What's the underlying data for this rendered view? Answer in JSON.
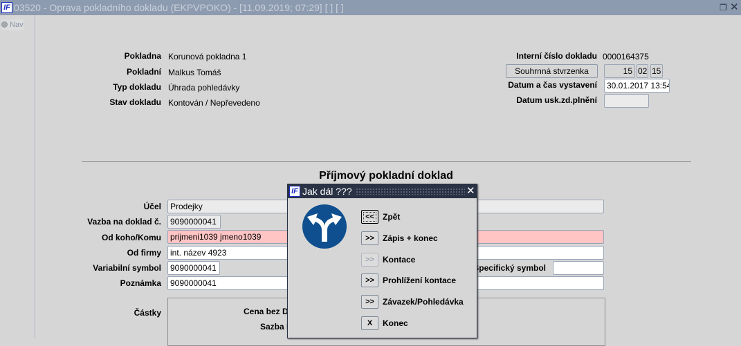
{
  "window": {
    "title": "03520 - Oprava pokladního dokladu (EKPVPOKO) - [11.09.2019; 07:29]  [ ]  [ ]",
    "logo": "IF"
  },
  "nav": {
    "label": "Nav"
  },
  "header": {
    "pokladna_label": "Pokladna",
    "pokladna": "Korunová pokladna 1",
    "pokladni_label": "Pokladní",
    "pokladni": "Malkus Tomáš",
    "typ_label": "Typ dokladu",
    "typ": "Úhrada pohledávky",
    "stav_label": "Stav dokladu",
    "stav": "Kontován / Nepřevedeno",
    "interni_label": "Interní číslo dokladu",
    "interni": "0000164375",
    "souhrnna_button": "Souhrnná stvrzenka",
    "code1": "15",
    "code2": "02",
    "code3": "15",
    "datum_label": "Datum a čas vystavení",
    "datum": "30.01.2017 13:54",
    "usk_label": "Datum usk.zd.plnění",
    "usk": ""
  },
  "form": {
    "heading": "Příjmový pokladní doklad",
    "ucel_label": "Účel",
    "ucel": "Prodejky",
    "vazba_label": "Vazba na doklad č.",
    "vazba": "9090000041",
    "odkoho_label": "Od koho/Komu",
    "odkoho": "prijmeni1039 jmeno1039",
    "firma_label": "Od firmy",
    "firma": "int. název 4923",
    "vs_label": "Variabilní symbol",
    "vs": "9090000041",
    "ss_label": "Specifický symbol",
    "ss": "",
    "poznamka_label": "Poznámka",
    "poznamka": "9090000041",
    "castky_label": "Částky",
    "cena_label": "Cena bez D",
    "sazba_label": "Sazba D"
  },
  "dialog": {
    "title": "Jak dál ???",
    "icon": "fork-direction-sign-icon",
    "items": [
      {
        "btn": "<<",
        "label": "Zpět"
      },
      {
        "btn": ">>",
        "label": "Zápis + konec"
      },
      {
        "btn": ">>",
        "label": "Kontace"
      },
      {
        "btn": ">>",
        "label": "Prohlížení kontace"
      },
      {
        "btn": ">>",
        "label": "Závazek/Pohledávka"
      },
      {
        "btn": "X",
        "label": "Konec"
      }
    ]
  },
  "colors": {
    "titlebar": "#8d9bb0",
    "dialog_title": "#2a3345",
    "required_field": "#ffc4c4",
    "sign_blue": "#0f4f8f"
  }
}
